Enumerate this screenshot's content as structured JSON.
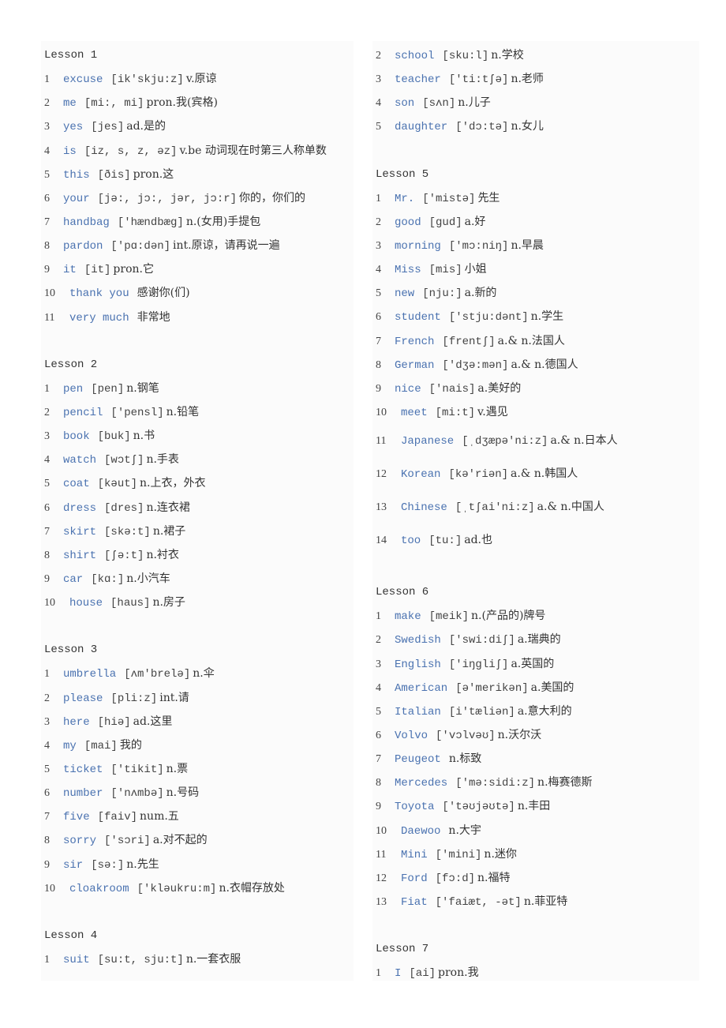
{
  "colors": {
    "word": "#4a72b0",
    "text": "#333333",
    "panel": "#fbfbfb"
  },
  "columns": [
    {
      "lessons": [
        {
          "title": "Lesson 1",
          "entries": [
            {
              "n": "1",
              "word": "excuse",
              "phonetic": "[ik'skju:z]",
              "definition": "v.原谅"
            },
            {
              "n": "2",
              "word": "me",
              "phonetic": "[mi:, mi]",
              "definition": "pron.我(宾格)"
            },
            {
              "n": "3",
              "word": "yes",
              "phonetic": "[jes]",
              "definition": "ad.是的"
            },
            {
              "n": "4",
              "word": "is",
              "phonetic": "[iz, s, z, əz]",
              "definition": "v.be 动词现在时第三人称单数"
            },
            {
              "n": "5",
              "word": "this",
              "phonetic": "[ðis]",
              "definition": "pron.这"
            },
            {
              "n": "6",
              "word": "your",
              "phonetic": "[jə:, jɔ:, jər, jɔ:r]",
              "definition": "你的，你们的"
            },
            {
              "n": "7",
              "word": "handbag",
              "phonetic": "['hændbæg]",
              "definition": "n.(女用)手提包"
            },
            {
              "n": "8",
              "word": "pardon",
              "phonetic": "['pɑ:dən]",
              "definition": "int.原谅，请再说一遍"
            },
            {
              "n": "9",
              "word": "it",
              "phonetic": "[it]",
              "definition": "pron.它"
            },
            {
              "n": "10",
              "word": "thank you",
              "phonetic": "",
              "definition": "感谢你(们)"
            },
            {
              "n": "11",
              "word": "very much",
              "phonetic": "",
              "definition": "非常地"
            }
          ]
        },
        {
          "title": "Lesson 2",
          "entries": [
            {
              "n": "1",
              "word": "pen",
              "phonetic": "[pen]",
              "definition": "n.钢笔"
            },
            {
              "n": "2",
              "word": "pencil",
              "phonetic": "['pensl]",
              "definition": "n.铅笔"
            },
            {
              "n": "3",
              "word": "book",
              "phonetic": "[buk]",
              "definition": "n.书"
            },
            {
              "n": "4",
              "word": "watch",
              "phonetic": "[wɔtʃ]",
              "definition": "n.手表"
            },
            {
              "n": "5",
              "word": "coat",
              "phonetic": "[kəut]",
              "definition": "n.上衣，外衣"
            },
            {
              "n": "6",
              "word": "dress",
              "phonetic": "[dres]",
              "definition": "n.连衣裙"
            },
            {
              "n": "7",
              "word": "skirt",
              "phonetic": "[skə:t]",
              "definition": "n.裙子"
            },
            {
              "n": "8",
              "word": "shirt",
              "phonetic": "[ʃə:t]",
              "definition": "n.衬衣"
            },
            {
              "n": "9",
              "word": "car",
              "phonetic": "[kɑ:]",
              "definition": "n.小汽车"
            },
            {
              "n": "10",
              "word": "house",
              "phonetic": "[haus]",
              "definition": "n.房子"
            }
          ]
        },
        {
          "title": "Lesson 3",
          "entries": [
            {
              "n": "1",
              "word": "umbrella",
              "phonetic": "[ʌm'brelə]",
              "definition": "n.伞"
            },
            {
              "n": "2",
              "word": "please",
              "phonetic": "[pli:z]",
              "definition": "int.请"
            },
            {
              "n": "3",
              "word": "here",
              "phonetic": "[hiə]",
              "definition": "ad.这里"
            },
            {
              "n": "4",
              "word": "my",
              "phonetic": "[mai]",
              "definition": "我的"
            },
            {
              "n": "5",
              "word": "ticket",
              "phonetic": "['tikit]",
              "definition": "n.票"
            },
            {
              "n": "6",
              "word": "number",
              "phonetic": "['nʌmbə]",
              "definition": "n.号码"
            },
            {
              "n": "7",
              "word": "five",
              "phonetic": "[faiv]",
              "definition": "num.五"
            },
            {
              "n": "8",
              "word": "sorry",
              "phonetic": "['sɔri]",
              "definition": "a.对不起的"
            },
            {
              "n": "9",
              "word": "sir",
              "phonetic": "[sə:]",
              "definition": "n.先生"
            },
            {
              "n": "10",
              "word": "cloakroom",
              "phonetic": "['kləukru:m]",
              "definition": "n.衣帽存放处"
            }
          ]
        },
        {
          "title": "Lesson 4",
          "entries": [
            {
              "n": "1",
              "word": "suit",
              "phonetic": "[su:t, sju:t]",
              "definition": "n.一套衣服"
            }
          ]
        }
      ]
    },
    {
      "lessons": [
        {
          "title": "",
          "entries": [
            {
              "n": "2",
              "word": "school",
              "phonetic": "[sku:l]",
              "definition": "n.学校"
            },
            {
              "n": "3",
              "word": "teacher",
              "phonetic": "['ti:tʃə]",
              "definition": "n.老师"
            },
            {
              "n": "4",
              "word": "son",
              "phonetic": "[sʌn]",
              "definition": "n.儿子"
            },
            {
              "n": "5",
              "word": "daughter",
              "phonetic": "['dɔ:tə]",
              "definition": "n.女儿"
            }
          ]
        },
        {
          "title": "Lesson 5",
          "entries": [
            {
              "n": "1",
              "word": "Mr.",
              "phonetic": "['mistə]",
              "definition": "先生"
            },
            {
              "n": "2",
              "word": "good",
              "phonetic": "[gud]",
              "definition": "a.好"
            },
            {
              "n": "3",
              "word": "morning",
              "phonetic": "['mɔ:niŋ]",
              "definition": "n.早晨"
            },
            {
              "n": "4",
              "word": "Miss",
              "phonetic": "[mis]",
              "definition": "小姐"
            },
            {
              "n": "5",
              "word": "new",
              "phonetic": "[nju:]",
              "definition": "a.新的"
            },
            {
              "n": "6",
              "word": "student",
              "phonetic": "['stju:dənt]",
              "definition": "n.学生"
            },
            {
              "n": "7",
              "word": "French",
              "phonetic": "[frentʃ]",
              "definition": "a.& n.法国人"
            },
            {
              "n": "8",
              "word": "German",
              "phonetic": "['dʒə:mən]",
              "definition": "a.& n.德国人"
            },
            {
              "n": "9",
              "word": "nice",
              "phonetic": "['nais]",
              "definition": "a.美好的"
            },
            {
              "n": "10",
              "word": "meet",
              "phonetic": "[mi:t]",
              "definition": "v.遇见"
            },
            {
              "n": "11",
              "word": "Japanese",
              "phonetic": "[ˌdʒæpə'ni:z]",
              "definition": "a.& n.日本人",
              "tall": true
            },
            {
              "n": "12",
              "word": "Korean",
              "phonetic": "[kə'riən]",
              "definition": "a.& n.韩国人",
              "tall": true
            },
            {
              "n": "13",
              "word": "Chinese",
              "phonetic": "[ˌtʃai'ni:z]",
              "definition": "a.& n.中国人",
              "tall": true
            },
            {
              "n": "14",
              "word": "too",
              "phonetic": "[tu:]",
              "definition": "ad.也",
              "tall": true
            }
          ]
        },
        {
          "title": "Lesson 6",
          "entries": [
            {
              "n": "1",
              "word": "make",
              "phonetic": "[meik]",
              "definition": "n.(产品的)牌号"
            },
            {
              "n": "2",
              "word": "Swedish",
              "phonetic": "['swi:diʃ]",
              "definition": "a.瑞典的"
            },
            {
              "n": "3",
              "word": "English",
              "phonetic": "['iŋgliʃ]",
              "definition": "a.英国的"
            },
            {
              "n": "4",
              "word": "American",
              "phonetic": "[ə'merikən]",
              "definition": "a.美国的"
            },
            {
              "n": "5",
              "word": "Italian",
              "phonetic": "[i'tæliən]",
              "definition": "a.意大利的"
            },
            {
              "n": "6",
              "word": "Volvo",
              "phonetic": "['vɔlvəʊ]",
              "definition": "n.沃尔沃"
            },
            {
              "n": "7",
              "word": "Peugeot",
              "phonetic": "",
              "definition": "n.标致"
            },
            {
              "n": "8",
              "word": "Mercedes",
              "phonetic": "['mə:sidi:z]",
              "definition": "n.梅赛德斯"
            },
            {
              "n": "9",
              "word": "Toyota",
              "phonetic": "['təʊjəʊtə]",
              "definition": "n.丰田"
            },
            {
              "n": "10",
              "word": "Daewoo",
              "phonetic": "",
              "definition": "n.大宇"
            },
            {
              "n": "11",
              "word": "Mini",
              "phonetic": "['mini]",
              "definition": "n.迷你"
            },
            {
              "n": "12",
              "word": "Ford",
              "phonetic": "[fɔ:d]",
              "definition": "n.福特"
            },
            {
              "n": "13",
              "word": "Fiat",
              "phonetic": "['faiæt, -ət]",
              "definition": "n.菲亚特"
            }
          ]
        },
        {
          "title": "Lesson 7",
          "entries": [
            {
              "n": "1",
              "word": "I",
              "phonetic": "[ai]",
              "definition": "pron.我"
            }
          ]
        }
      ]
    }
  ]
}
